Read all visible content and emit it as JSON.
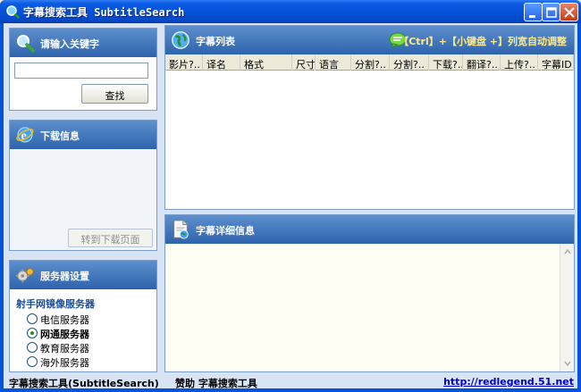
{
  "window": {
    "title": "字幕搜索工具 SubtitleSearch",
    "accent": "#0553D9"
  },
  "search_panel": {
    "header": "请输入关键字",
    "input_value": "",
    "search_button": "查找"
  },
  "download_panel": {
    "header": "下载信息",
    "goto_button": "转到下载页面"
  },
  "server_panel": {
    "header": "服务器设置",
    "group_label": "射手网镜像服务器",
    "options": [
      {
        "label": "电信服务器",
        "checked": false
      },
      {
        "label": "网通服务器",
        "checked": true
      },
      {
        "label": "教育服务器",
        "checked": false
      },
      {
        "label": "海外服务器",
        "checked": false
      }
    ]
  },
  "subtitle_list": {
    "header": "字幕列表",
    "hint": "【Ctrl】+【小键盘 +】列宽自动调整",
    "columns": [
      "影片?..",
      "译名",
      "格式",
      "尺寸",
      "语言",
      "分割?..",
      "分割?..",
      "下载?..",
      "翻译?..",
      "上传?..",
      "字幕ID"
    ]
  },
  "detail_panel": {
    "header": "字幕详细信息"
  },
  "status": {
    "left": "字幕搜索工具(SubtitleSearch)",
    "middle": "赞助 字幕搜索工具",
    "link": "http://redlegend.51.net"
  }
}
